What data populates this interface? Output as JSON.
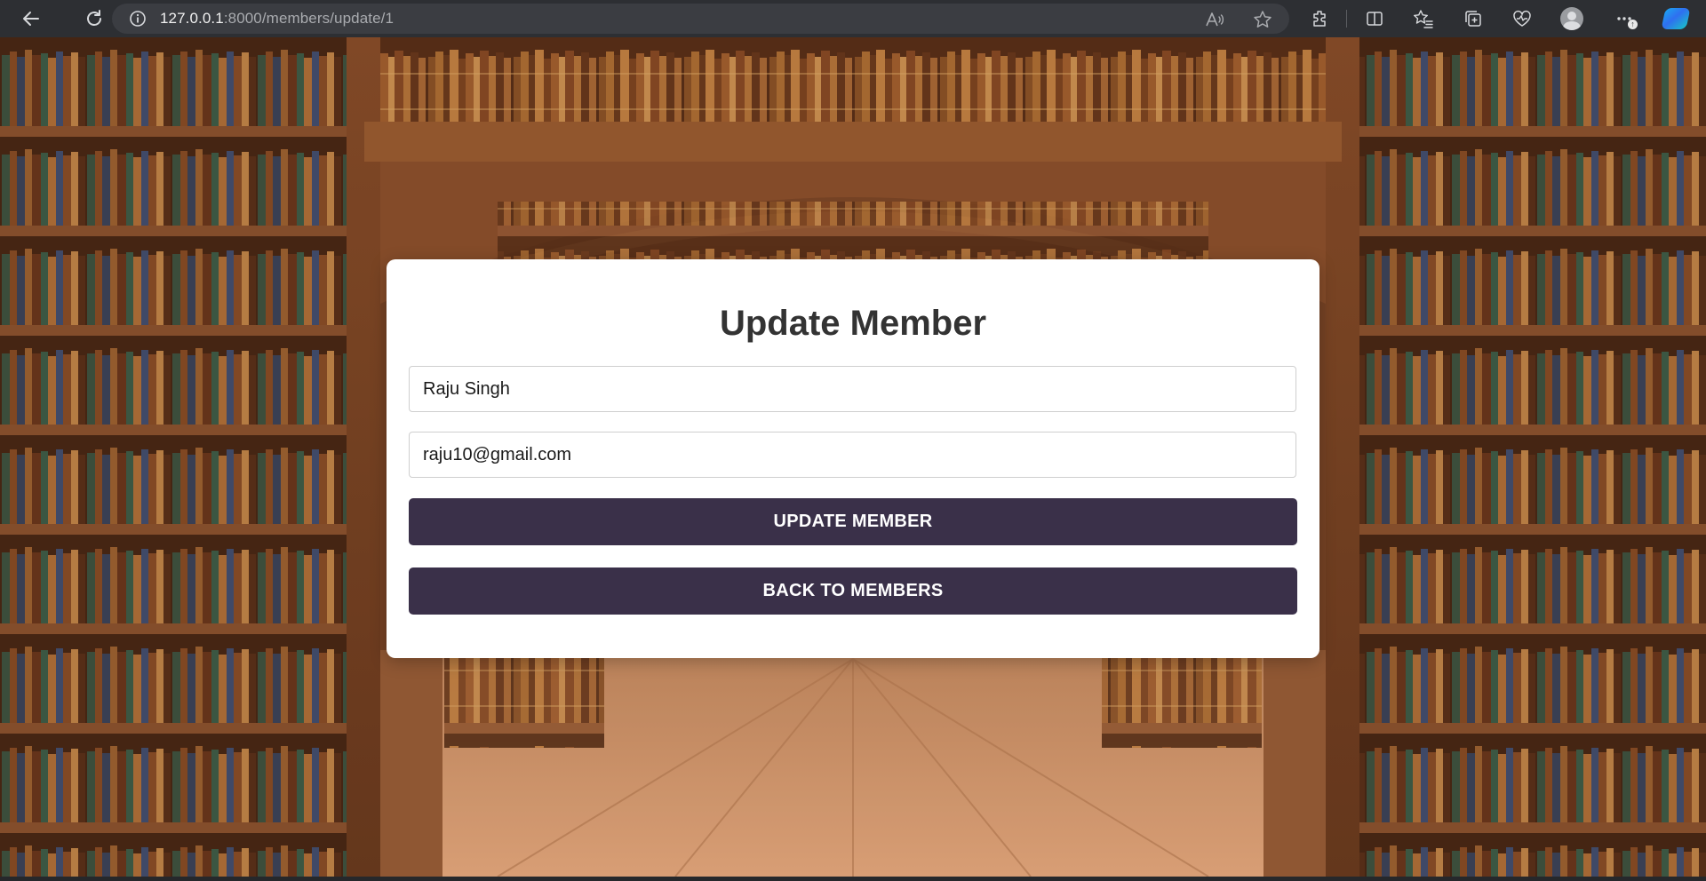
{
  "browser": {
    "url_host": "127.0.0.1",
    "url_rest": ":8000/members/update/1",
    "icons": [
      "back-icon",
      "reload-icon",
      "site-info-icon",
      "read-aloud-icon",
      "favorite-star-icon",
      "extensions-icon",
      "split-screen-icon",
      "favorites-icon",
      "collections-icon",
      "browser-essentials-icon",
      "profile-icon",
      "more-menu-icon",
      "copilot-icon"
    ],
    "update_badge": "↑"
  },
  "form": {
    "title": "Update Member",
    "name_value": "Raju Singh",
    "email_value": "raju10@gmail.com",
    "update_label": "UPDATE MEMBER",
    "back_label": "BACK TO MEMBERS"
  },
  "colors": {
    "button_bg": "#3a3049",
    "card_bg": "#ffffff",
    "title_text": "#333333",
    "chrome_bg": "#2d2f33"
  }
}
